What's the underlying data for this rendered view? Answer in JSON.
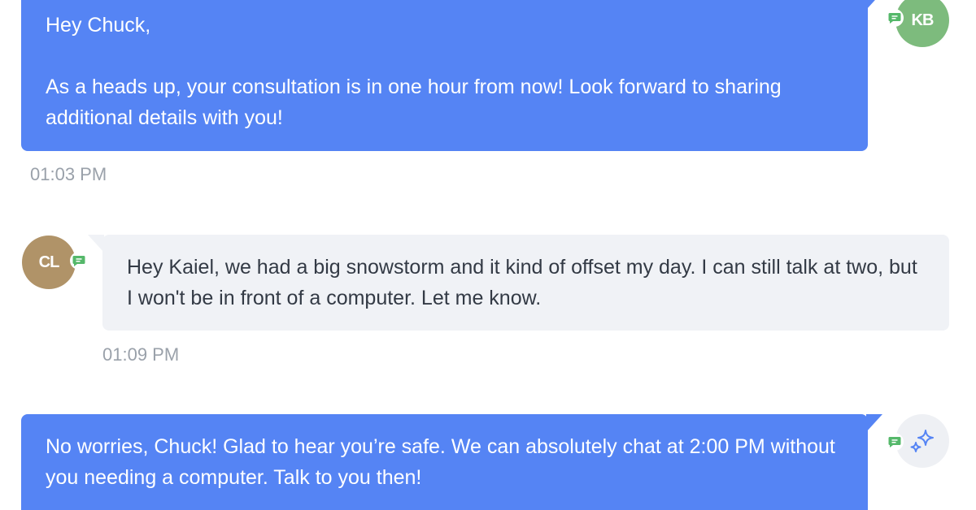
{
  "messages": [
    {
      "sender_initials": "KB",
      "text": "Hey Chuck,\n\nAs a heads up, your consultation is in one hour from now! Look forward to sharing additional details with you!",
      "time": "01:03 PM"
    },
    {
      "sender_initials": "CL",
      "text": "Hey Kaiel, we had a big snowstorm and it kind of offset my day. I can still talk at two, but I won't be in front of a computer. Let me know.",
      "time": "01:09 PM"
    },
    {
      "sender_icon": "sparkle-icon",
      "text": "No worries, Chuck! Glad to hear you’re safe. We can absolutely chat at 2:00 PM without you needing a computer. Talk to you then!"
    }
  ],
  "colors": {
    "outgoing_bubble": "#5584f4",
    "incoming_bubble": "#f0f2f6",
    "sms_badge": "#55b86a"
  }
}
